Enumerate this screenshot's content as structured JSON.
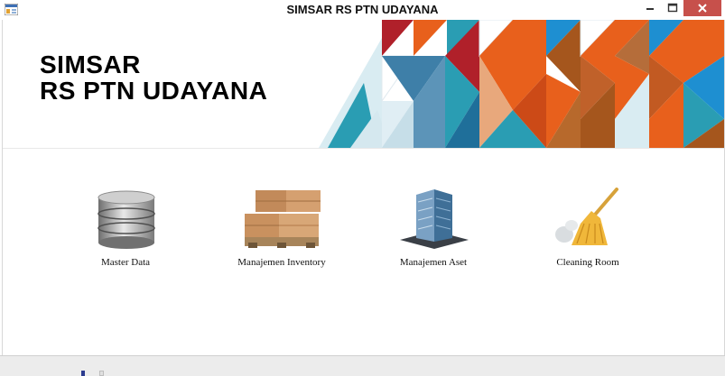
{
  "window": {
    "title": "SIMSAR RS PTN UDAYANA",
    "icon": "app-window-icon",
    "controls": {
      "minimize": "–",
      "maximize": "□",
      "close": "✕"
    }
  },
  "banner": {
    "line1": "SIMSAR",
    "line2": "RS PTN UDAYANA",
    "colors": {
      "orange": "#e8601c",
      "red": "#b0202a",
      "teal": "#2a9db3",
      "blue": "#1e8fd1",
      "brown": "#a5561d"
    }
  },
  "modules": [
    {
      "label": "Master Data",
      "icon": "database-icon"
    },
    {
      "label": "Manajemen Inventory",
      "icon": "boxes-pallet-icon"
    },
    {
      "label": "Manajemen Aset",
      "icon": "building-icon"
    },
    {
      "label": "Cleaning Room",
      "icon": "broom-icon"
    }
  ]
}
